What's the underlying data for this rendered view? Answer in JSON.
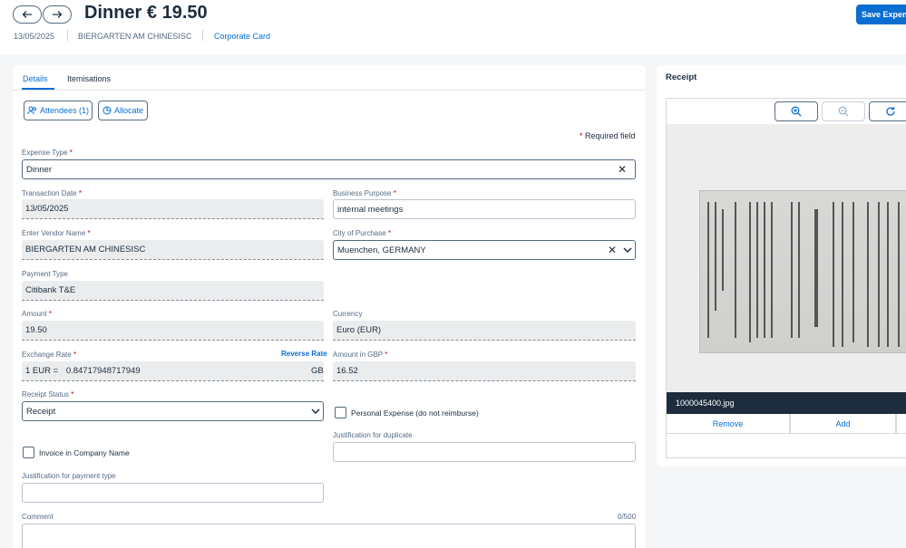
{
  "header": {
    "back_icon": "arrow-left-icon",
    "forward_icon": "arrow-right-icon",
    "title": "Dinner € 19.50",
    "date": "13/05/2025",
    "vendor": "BIERGARTEN AM CHINESISC",
    "payment_method": "Corporate Card",
    "save_label": "Save Expense",
    "accent_color": "#0a6ed1"
  },
  "tabs": [
    {
      "label": "Details",
      "active": true
    },
    {
      "label": "Itemisations",
      "active": false
    }
  ],
  "actions": {
    "attendees_label": "Attendees (1)",
    "allocate_label": "Allocate"
  },
  "required_note": "Required field",
  "required_star": "*",
  "form": {
    "expense_type": {
      "label": "Expense Type",
      "value": "Dinner"
    },
    "transaction_date": {
      "label": "Transaction Date",
      "value": "13/05/2025"
    },
    "business_purpose": {
      "label": "Business Purpose",
      "value": "internal meetings"
    },
    "vendor_name": {
      "label": "Enter Vendor Name",
      "value": "BIERGARTEN AM CHINESISC"
    },
    "city": {
      "label": "City of Purchase",
      "value": "Muenchen, GERMANY"
    },
    "payment_type": {
      "label": "Payment Type",
      "value": "Citibank T&E"
    },
    "amount": {
      "label": "Amount",
      "value": "19.50"
    },
    "currency": {
      "label": "Currency",
      "value": "Euro (EUR)"
    },
    "exchange_rate": {
      "label": "Exchange Rate",
      "prefix": "1 EUR =",
      "value": "0.84717948717949",
      "suffix": "GBP",
      "reverse_label": "Reverse Rate"
    },
    "amount_gbp": {
      "label": "Amount in GBP",
      "value": "16.52"
    },
    "receipt_status": {
      "label": "Receipt Status",
      "value": "Receipt"
    },
    "personal_expense": {
      "label": "Personal Expense (do not reimburse)",
      "checked": false
    },
    "invoice_company": {
      "label": "Invoice in Company Name",
      "checked": false
    },
    "justification_duplicate": {
      "label": "Justification for duplicate",
      "value": ""
    },
    "justification_payment": {
      "label": "Justification for payment type",
      "value": ""
    },
    "comment": {
      "label": "Comment",
      "value": "",
      "counter": "0/500"
    }
  },
  "receipt": {
    "title": "Receipt",
    "zoom_in_icon": "zoom-in-icon",
    "zoom_out_icon": "zoom-out-icon",
    "rotate_icon": "rotate-icon",
    "file_name": "1000045400.jpg",
    "remove_label": "Remove",
    "add_label": "Add"
  }
}
